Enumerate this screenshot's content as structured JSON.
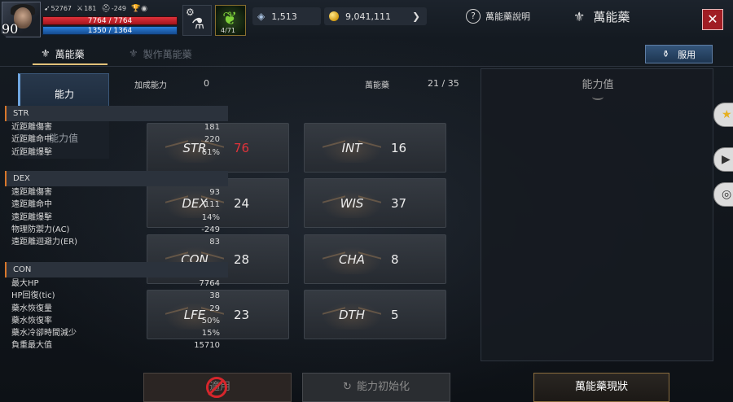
{
  "player": {
    "level": "90",
    "mini_stat_1": "52767",
    "mini_stat_2": "181",
    "mini_stat_3": "-249",
    "hp": "7764 / 7764",
    "mp": "1350 / 1364"
  },
  "slots": {
    "potion_count": "4/71"
  },
  "currency": {
    "crystal": "1,513",
    "gold": "9,041,111"
  },
  "header": {
    "help_label": "萬能藥說明",
    "title": "萬能藥",
    "close_icon": "close-icon"
  },
  "tabs": {
    "elixir": "萬能藥",
    "craft": "製作萬能藥",
    "use_button": "服用"
  },
  "sidebar": {
    "ability": "能力",
    "stat_values": "能力值"
  },
  "center": {
    "bonus_label": "加成能力",
    "bonus_value": "0",
    "elixir_label": "萬能藥",
    "elixir_value": "21 / 35"
  },
  "stats": [
    {
      "name": "STR",
      "value": "76",
      "highlight": true
    },
    {
      "name": "INT",
      "value": "16"
    },
    {
      "name": "DEX",
      "value": "24"
    },
    {
      "name": "WIS",
      "value": "37"
    },
    {
      "name": "CON",
      "value": "28"
    },
    {
      "name": "CHA",
      "value": "8"
    },
    {
      "name": "LFE",
      "value": "23"
    },
    {
      "name": "DTH",
      "value": "5"
    }
  ],
  "stat_panel": {
    "title": "能力值",
    "groups": [
      {
        "name": "STR",
        "rows": [
          {
            "label": "近距離傷害",
            "value": "181"
          },
          {
            "label": "近距離命中",
            "value": "220"
          },
          {
            "label": "近距離爆擊",
            "value": "61%"
          }
        ]
      },
      {
        "name": "DEX",
        "rows": [
          {
            "label": "遠距離傷害",
            "value": "93"
          },
          {
            "label": "遠距離命中",
            "value": "111"
          },
          {
            "label": "遠距離爆擊",
            "value": "14%"
          },
          {
            "label": "物理防禦力(AC)",
            "value": "-249"
          },
          {
            "label": "遠距離迴避力(ER)",
            "value": "83"
          }
        ]
      },
      {
        "name": "CON",
        "rows": [
          {
            "label": "最大HP",
            "value": "7764"
          },
          {
            "label": "HP回復(tic)",
            "value": "38"
          },
          {
            "label": "藥水恢復量",
            "value": "29"
          },
          {
            "label": "藥水恢復率",
            "value": "50%"
          },
          {
            "label": "藥水冷卻時間減少",
            "value": "15%"
          },
          {
            "label": "負重最大值",
            "value": "15710"
          }
        ]
      }
    ]
  },
  "buttons": {
    "apply": "適用",
    "reset": "能力初始化",
    "status": "萬能藥現狀"
  },
  "colors": {
    "highlight_red": "#e0333a",
    "accent_gold": "#e3c27a",
    "hp_red": "#e0313a",
    "mp_blue": "#2a7fd8"
  }
}
